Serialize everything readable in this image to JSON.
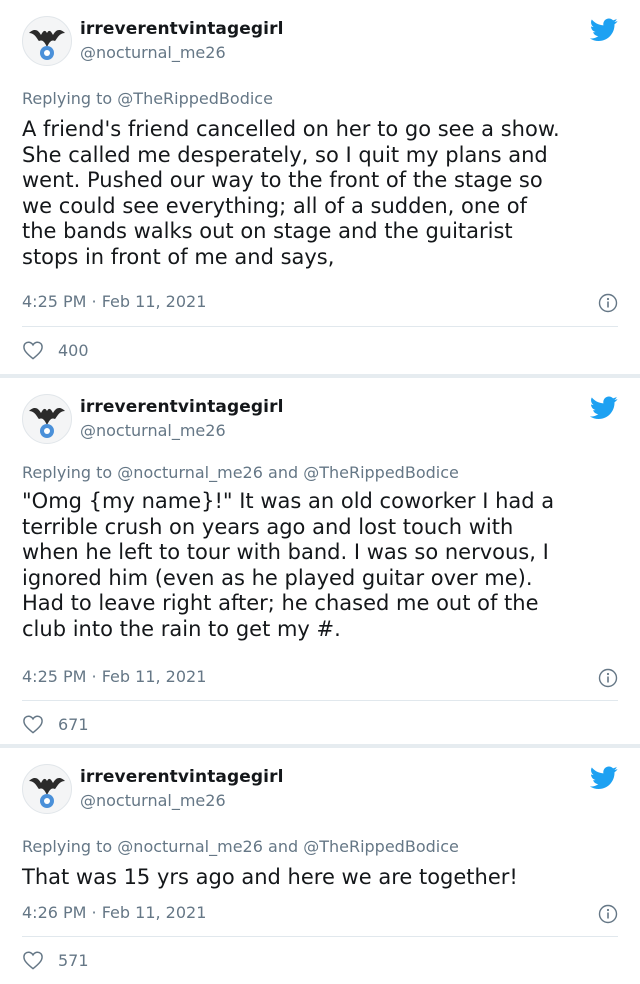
{
  "tweets": [
    {
      "name": "irreverentvintagegirl",
      "handle": "@nocturnal_me26",
      "replying_prefix": "Replying to ",
      "replying_to": "@TheRippedBodice",
      "replying_join": "",
      "replying_to_2": "",
      "text": "A friend's friend cancelled on her to go see a show.\nShe called me desperately, so I quit my plans and\nwent. Pushed our way to the front of the stage so\nwe could see everything; all of a sudden, one of\nthe bands walks out on stage and the guitarist\nstops in front of me and says,",
      "time": "4:25 PM · Feb 11, 2021",
      "likes": "400"
    },
    {
      "name": "irreverentvintagegirl",
      "handle": "@nocturnal_me26",
      "replying_prefix": "Replying to ",
      "replying_to": "@nocturnal_me26",
      "replying_join": " and ",
      "replying_to_2": "@TheRippedBodice",
      "text": "\"Omg {my name}!\" It was an old coworker I had a\nterrible crush on years ago and lost touch with\nwhen he left to tour with band. I was so nervous, I\nignored him (even as he played guitar over me).\nHad to leave right after; he chased me out of the\nclub into the rain to get my #.",
      "time": "4:25 PM · Feb 11, 2021",
      "likes": "671"
    },
    {
      "name": "irreverentvintagegirl",
      "handle": "@nocturnal_me26",
      "replying_prefix": "Replying to ",
      "replying_to": "@nocturnal_me26",
      "replying_join": " and ",
      "replying_to_2": "@TheRippedBodice",
      "text": "That was 15 yrs ago and here we are together!",
      "time": "4:26 PM · Feb 11, 2021",
      "likes": "571"
    }
  ],
  "colors": {
    "twitter_blue": "#1da1f2",
    "secondary_text": "#657786",
    "primary_text": "#14171a"
  }
}
